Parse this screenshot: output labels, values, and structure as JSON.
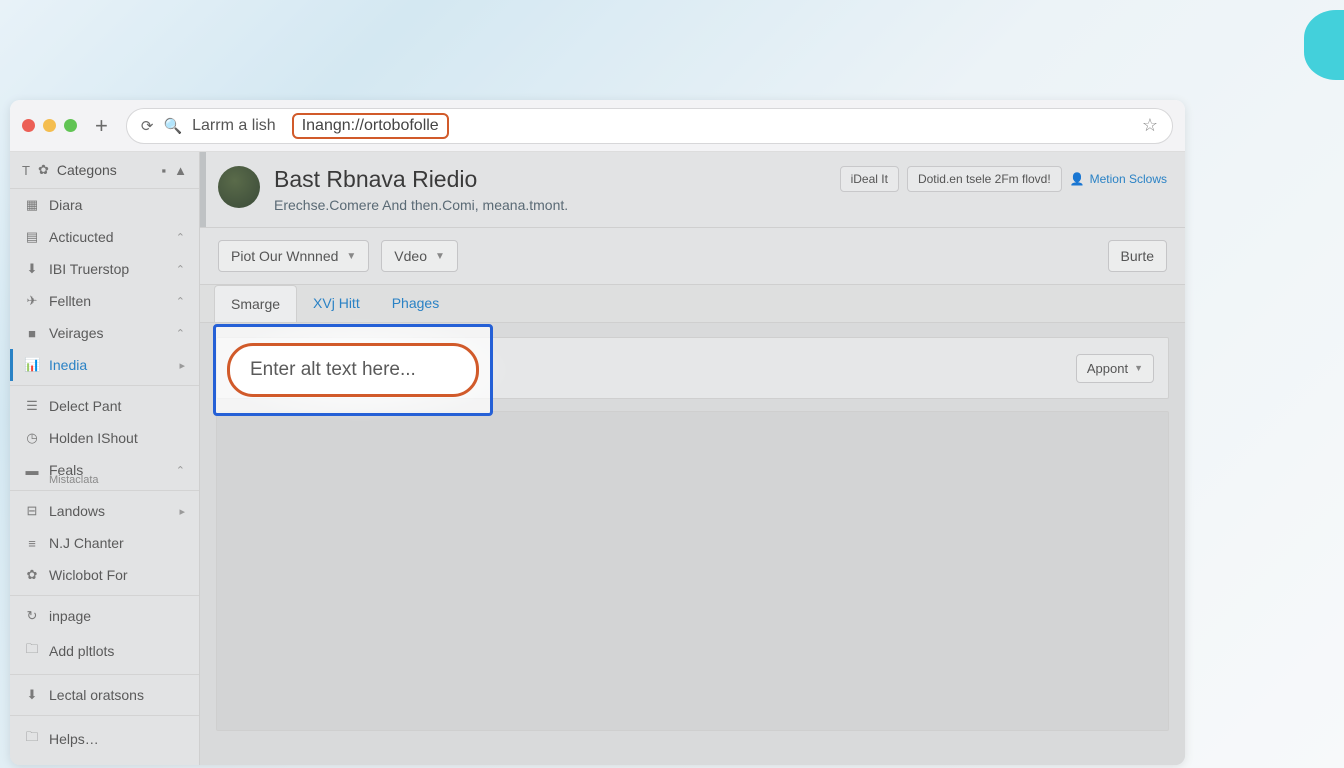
{
  "browser": {
    "address_label": "Larrm a lish",
    "address_url": "Inangn://ortobofolle"
  },
  "sidebar": {
    "header": "Categons",
    "items": [
      {
        "icon": "▦",
        "label": "Diara"
      },
      {
        "icon": "▤",
        "label": "Acticucted",
        "chev": true
      },
      {
        "icon": "⬇",
        "label": "IBI Truerstop",
        "chev": true
      },
      {
        "icon": "✈",
        "label": "Fellten",
        "chev": true
      },
      {
        "icon": "■",
        "label": "Veirages",
        "chev": true
      }
    ],
    "active": {
      "icon": "📊",
      "label": "Inedia"
    },
    "items2": [
      {
        "icon": "☰",
        "label": "Delect Pant"
      },
      {
        "icon": "◷",
        "label": "Holden IShout"
      },
      {
        "icon": "▬",
        "label": "Feals",
        "sub": "Mistaclata",
        "chev": true
      }
    ],
    "items3": [
      {
        "icon": "⊟",
        "label": "Landows",
        "chev": "▶"
      },
      {
        "icon": "≡",
        "label": "N.J Chanter"
      },
      {
        "icon": "✿",
        "label": "Wiclobot For"
      }
    ],
    "items4": [
      {
        "icon": "↻",
        "label": "inpage"
      },
      {
        "icon": "🗀",
        "label": "Add pltlots"
      }
    ],
    "items5": [
      {
        "icon": "⬇",
        "label": "Lectal oratsons"
      }
    ],
    "items6": [
      {
        "icon": "🗀",
        "label": "Helps…"
      }
    ]
  },
  "header": {
    "title": "Bast Rbnava Riedio",
    "subtitle": "Erechse.Comere And then.Comi, meana.tmont.",
    "btn1": "iDeal It",
    "btn2": "Dotid.en tsele 2Fm flovd!",
    "user_link": "Metion Sclows"
  },
  "toolbar": {
    "dropdown1": "Piot Our Wnnned",
    "dropdown2": "Vdeo",
    "right_btn": "Burte"
  },
  "tabs": [
    {
      "label": "Smarge",
      "active": true
    },
    {
      "label": "XVj Hitt"
    },
    {
      "label": "Phages"
    }
  ],
  "content": {
    "alt_text_placeholder": "Enter alt text here...",
    "appont_label": "Appont"
  }
}
